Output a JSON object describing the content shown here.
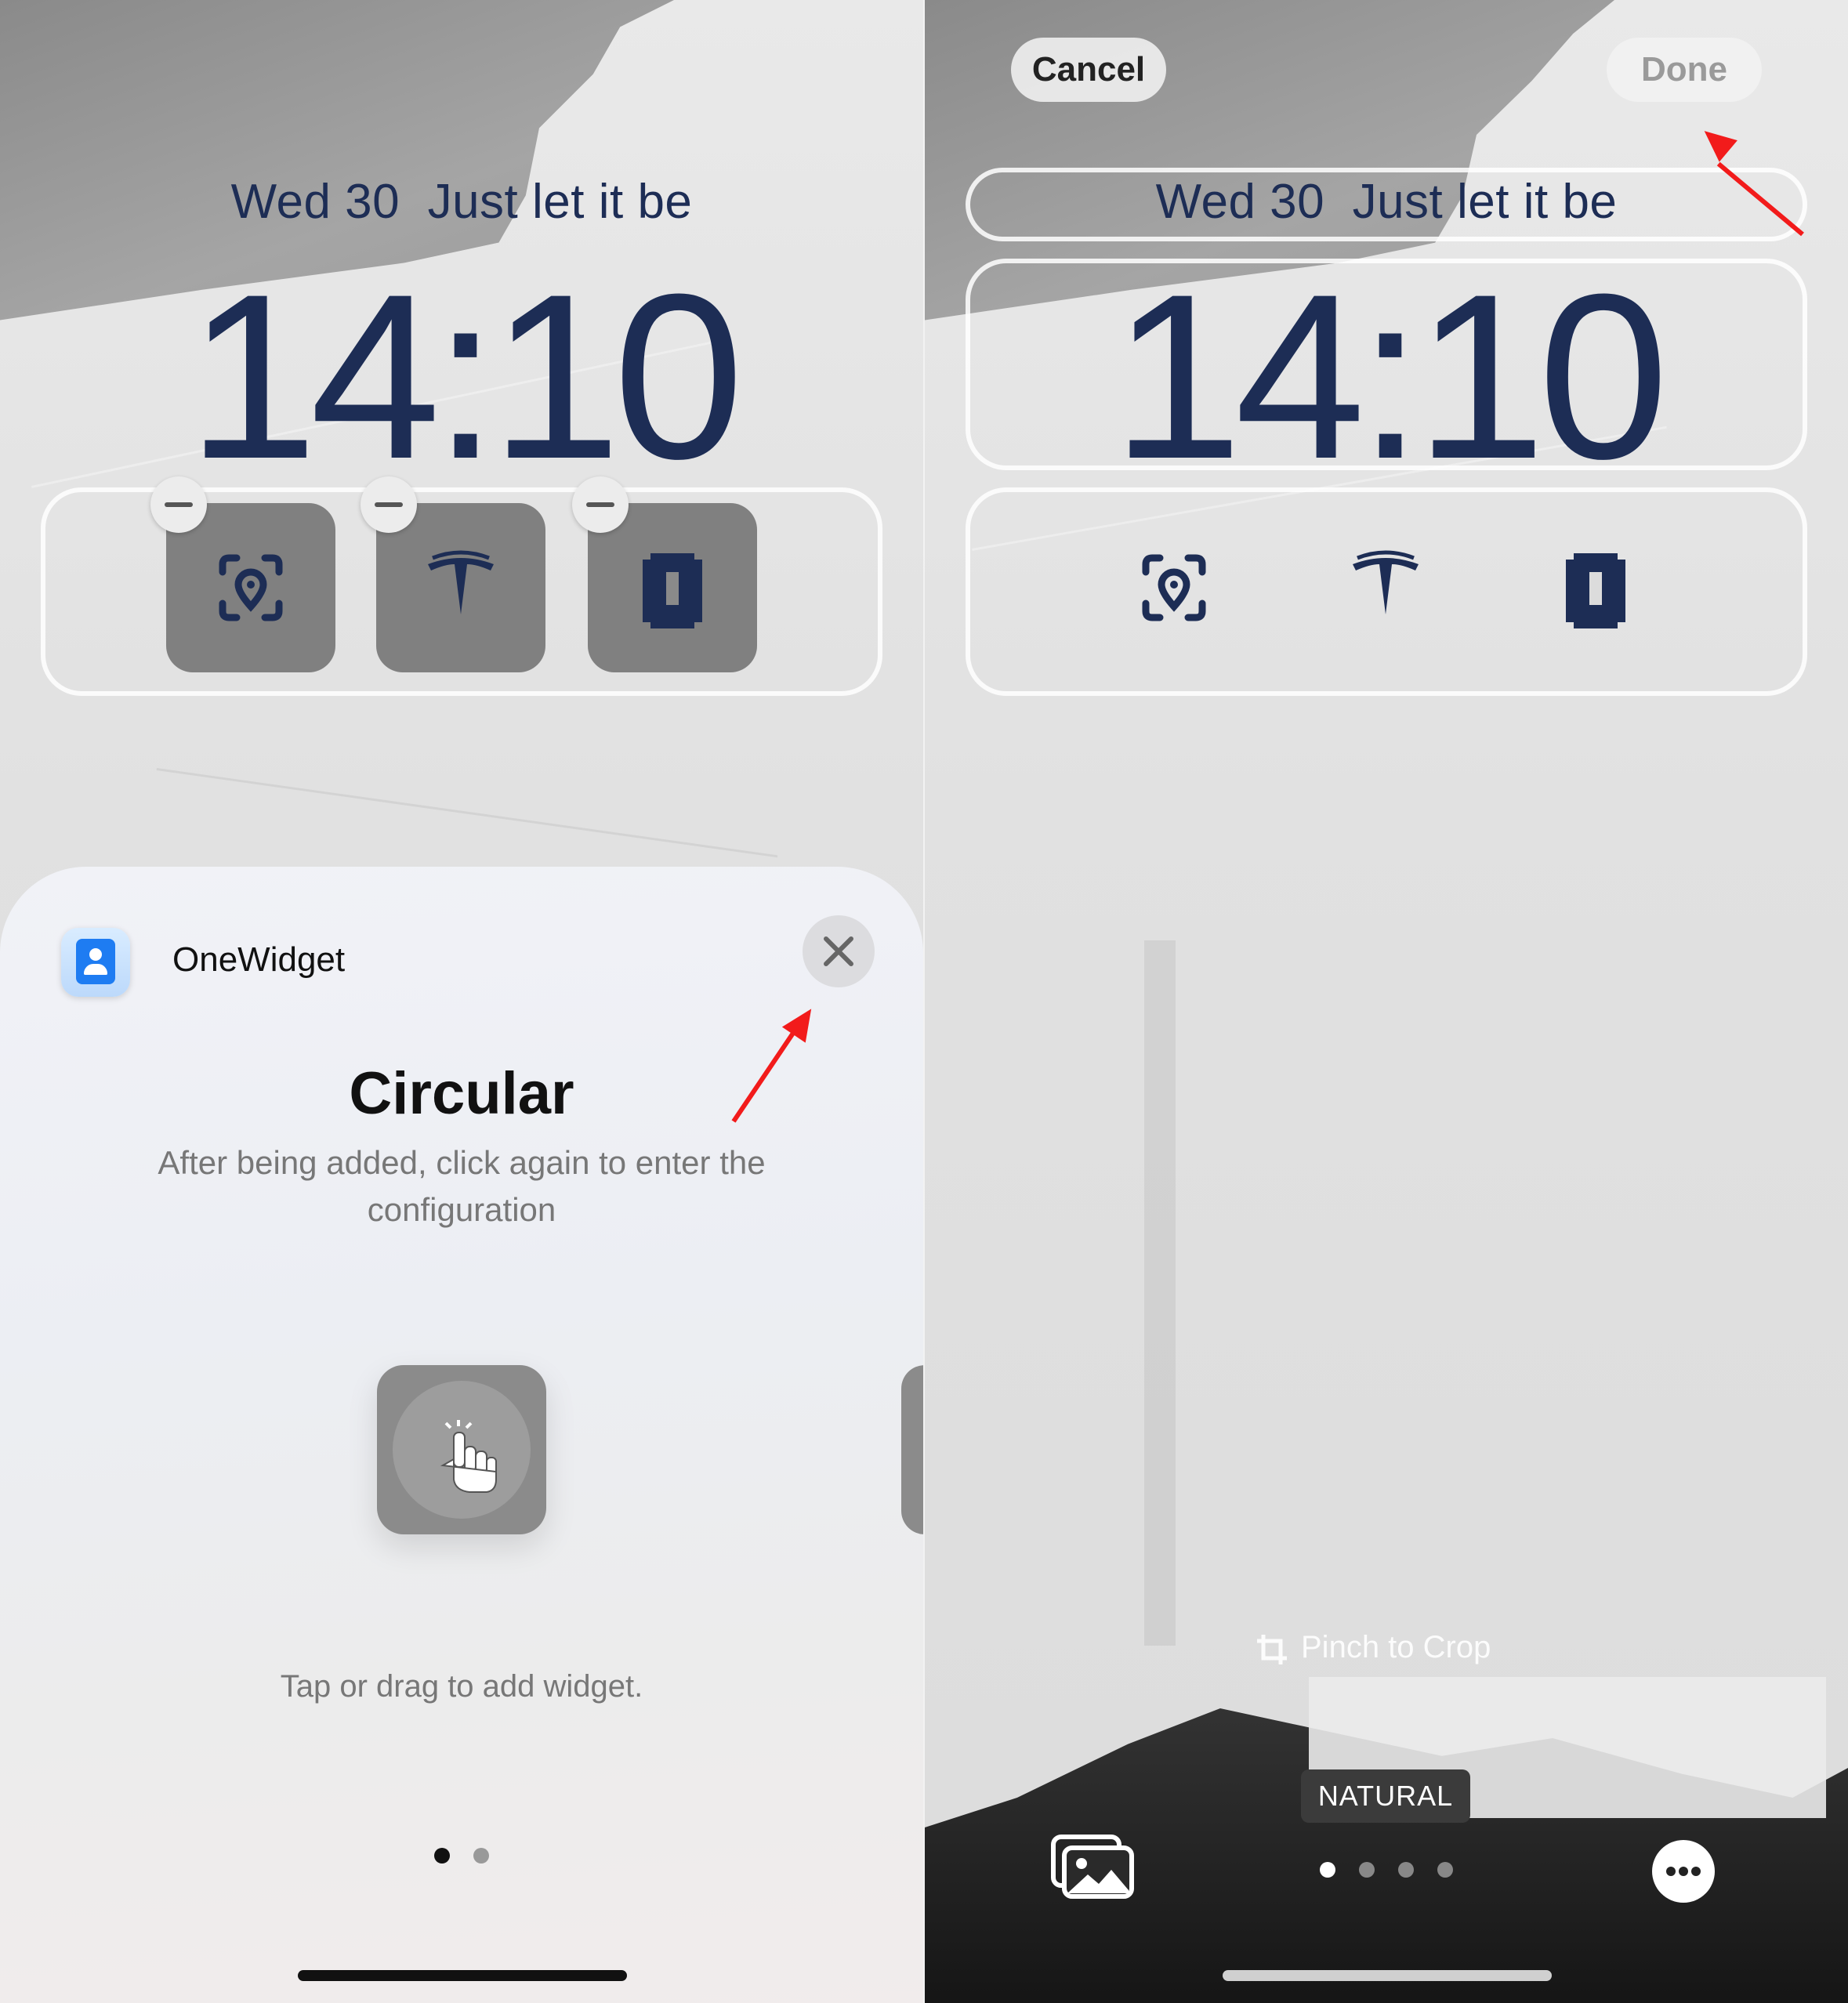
{
  "left_screen": {
    "date_line": "Wed 30  Just let it be",
    "time": "14:10",
    "widgets": [
      {
        "icon": "face-id-location-icon"
      },
      {
        "icon": "tesla-logo-icon"
      },
      {
        "icon": "battery-pixel-icon"
      }
    ],
    "sheet": {
      "app_name": "OneWidget",
      "close_icon": "close-icon",
      "title": "Circular",
      "subtitle": "After being added, click again to enter the configuration",
      "preview_icon": "tap-hand-icon",
      "hint": "Tap or drag to add widget.",
      "page_dots": 2,
      "active_dot": 0
    }
  },
  "right_screen": {
    "cancel_label": "Cancel",
    "done_label": "Done",
    "date_line": "Wed 30  Just let it be",
    "time": "14:10",
    "widgets": [
      {
        "icon": "face-id-location-icon"
      },
      {
        "icon": "tesla-logo-icon"
      },
      {
        "icon": "battery-pixel-icon"
      }
    ],
    "pinch_hint": "Pinch to Crop",
    "filter_label": "NATURAL",
    "gallery_icon": "photo-gallery-icon",
    "more_icon": "more-icon",
    "page_dots": 4,
    "active_dot": 0
  },
  "colors": {
    "clock_navy": "#1d2d55",
    "annotation_red": "#f21b1b"
  }
}
